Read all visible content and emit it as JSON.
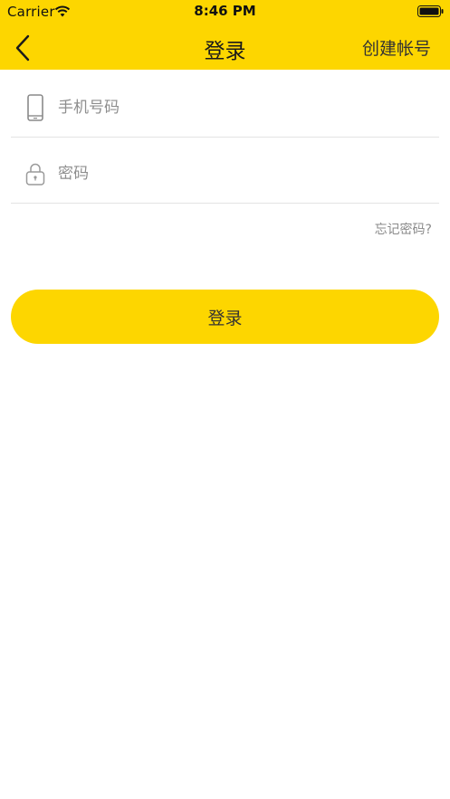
{
  "status_bar": {
    "carrier": "Carrier",
    "time": "8:46 PM"
  },
  "nav": {
    "title": "登录",
    "right_action": "创建帐号"
  },
  "form": {
    "phone_placeholder": "手机号码",
    "password_placeholder": "密码",
    "forgot_label": "忘记密码?",
    "submit_label": "登录"
  },
  "icons": {
    "back": "chevron-left-icon",
    "phone": "phone-icon",
    "lock": "lock-icon",
    "wifi": "wifi-icon",
    "battery": "battery-icon"
  },
  "colors": {
    "brand_yellow": "#FDD600",
    "text_primary": "#1a1a1a",
    "text_secondary": "#8e8e8e",
    "divider": "#e3e3e3"
  }
}
